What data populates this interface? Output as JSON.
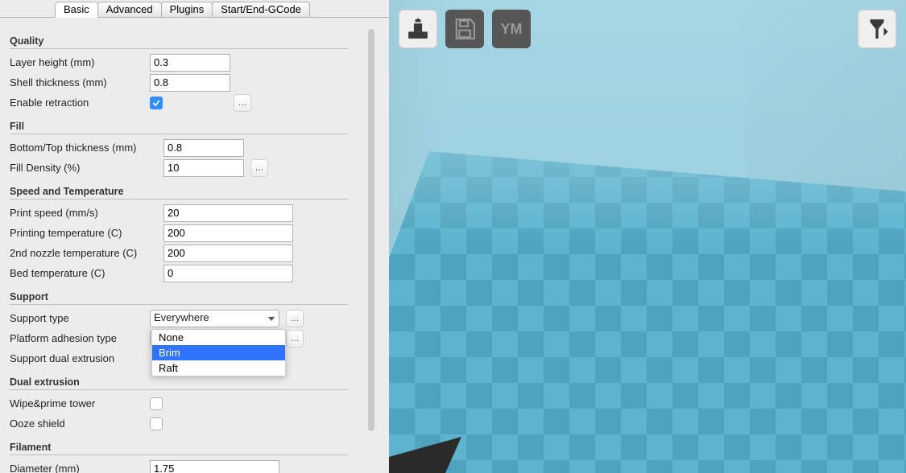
{
  "tabs": [
    "Basic",
    "Advanced",
    "Plugins",
    "Start/End-GCode"
  ],
  "active_tab": 0,
  "sections": {
    "quality": {
      "title": "Quality",
      "layer_height_label": "Layer height (mm)",
      "layer_height_val": "0.3",
      "shell_label": "Shell thickness (mm)",
      "shell_val": "0.8",
      "retract_label": "Enable retraction",
      "retract_checked": true
    },
    "fill": {
      "title": "Fill",
      "bt_label": "Bottom/Top thickness (mm)",
      "bt_val": "0.8",
      "density_label": "Fill Density (%)",
      "density_val": "10"
    },
    "speedtemp": {
      "title": "Speed and Temperature",
      "speed_label": "Print speed (mm/s)",
      "speed_val": "20",
      "ptemp_label": "Printing temperature (C)",
      "ptemp_val": "200",
      "ntemp_label": "2nd nozzle temperature (C)",
      "ntemp_val": "200",
      "btemp_label": "Bed temperature (C)",
      "btemp_val": "0"
    },
    "support": {
      "title": "Support",
      "type_label": "Support type",
      "type_val": "Everywhere",
      "adh_label": "Platform adhesion type",
      "adh_val": "Brim",
      "adh_options": [
        "None",
        "Brim",
        "Raft"
      ],
      "adh_selected": "Brim",
      "dual_label": "Support dual extrusion"
    },
    "dual": {
      "title": "Dual extrusion",
      "wipe_label": "Wipe&prime tower",
      "ooze_label": "Ooze shield"
    },
    "filament": {
      "title": "Filament",
      "dia_label": "Diameter (mm)",
      "dia_val": "1.75"
    }
  },
  "toolbar": {
    "load_icon": "load-model-icon",
    "save_icon": "save-icon",
    "ym_text": "YM",
    "view_icon": "view-mode-icon"
  }
}
